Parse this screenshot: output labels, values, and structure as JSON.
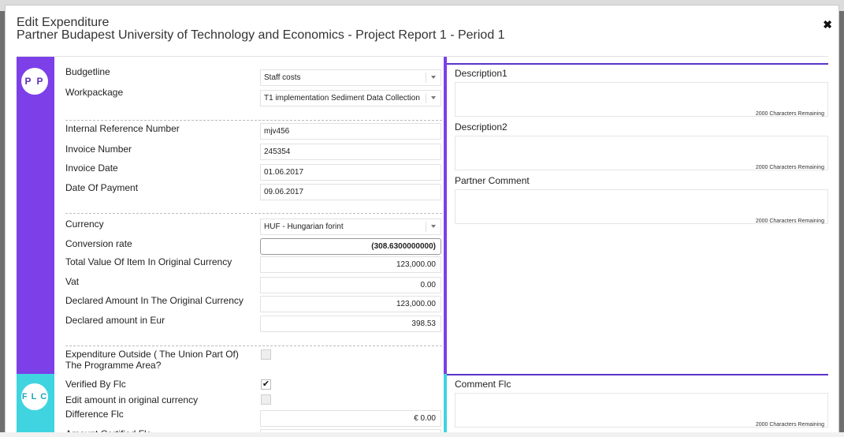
{
  "modal": {
    "title": "Edit Expenditure",
    "subtitle": "Partner Budapest University of Technology and Economics - Project Report 1 - Period 1",
    "close_icon": "✖"
  },
  "sections": {
    "pp_badge": "P P",
    "flc_badge": "F L C"
  },
  "fields": {
    "budgetline": {
      "label": "Budgetline",
      "value": "Staff costs"
    },
    "workpackage": {
      "label": "Workpackage",
      "value": "T1 implementation Sediment Data Collection"
    },
    "internal_ref": {
      "label": "Internal Reference Number",
      "value": "mjv456"
    },
    "invoice_number": {
      "label": "Invoice Number",
      "value": "245354"
    },
    "invoice_date": {
      "label": "Invoice Date",
      "value": "01.06.2017"
    },
    "date_of_payment": {
      "label": "Date Of Payment",
      "value": "09.06.2017"
    },
    "currency": {
      "label": "Currency",
      "value": "HUF - Hungarian forint"
    },
    "conversion_rate": {
      "label": "Conversion rate",
      "value": "(308.6300000000)"
    },
    "total_value": {
      "label": "Total Value Of Item In Original Currency",
      "value": "123,000.00"
    },
    "vat": {
      "label": "Vat",
      "value": "0.00"
    },
    "declared_original": {
      "label": "Declared Amount In The Original Currency",
      "value": "123,000.00"
    },
    "declared_eur": {
      "label": "Declared amount in Eur",
      "value": "398.53"
    },
    "outside_area": {
      "label": "Expenditure Outside ( The Union Part Of) The Programme Area?"
    },
    "verified_flc": {
      "label": "Verified By Flc",
      "check": "✔"
    },
    "edit_amount": {
      "label": "Edit amount in original currency"
    },
    "difference_flc": {
      "label": "Difference Flc",
      "value": "€ 0.00"
    },
    "amount_certified": {
      "label": "Amount Certified Flc"
    }
  },
  "right": {
    "description1": {
      "label": "Description1",
      "remaining": "2000 Characters Remaining"
    },
    "description2": {
      "label": "Description2",
      "remaining": "2000 Characters Remaining"
    },
    "partner_comment": {
      "label": "Partner Comment",
      "remaining": "2000 Characters Remaining"
    },
    "comment_flc": {
      "label": "Comment Flc",
      "remaining": "2000 Characters Remaining"
    }
  },
  "colors": {
    "pp_accent": "#7c3fe8",
    "flc_accent": "#3fd4e0"
  }
}
